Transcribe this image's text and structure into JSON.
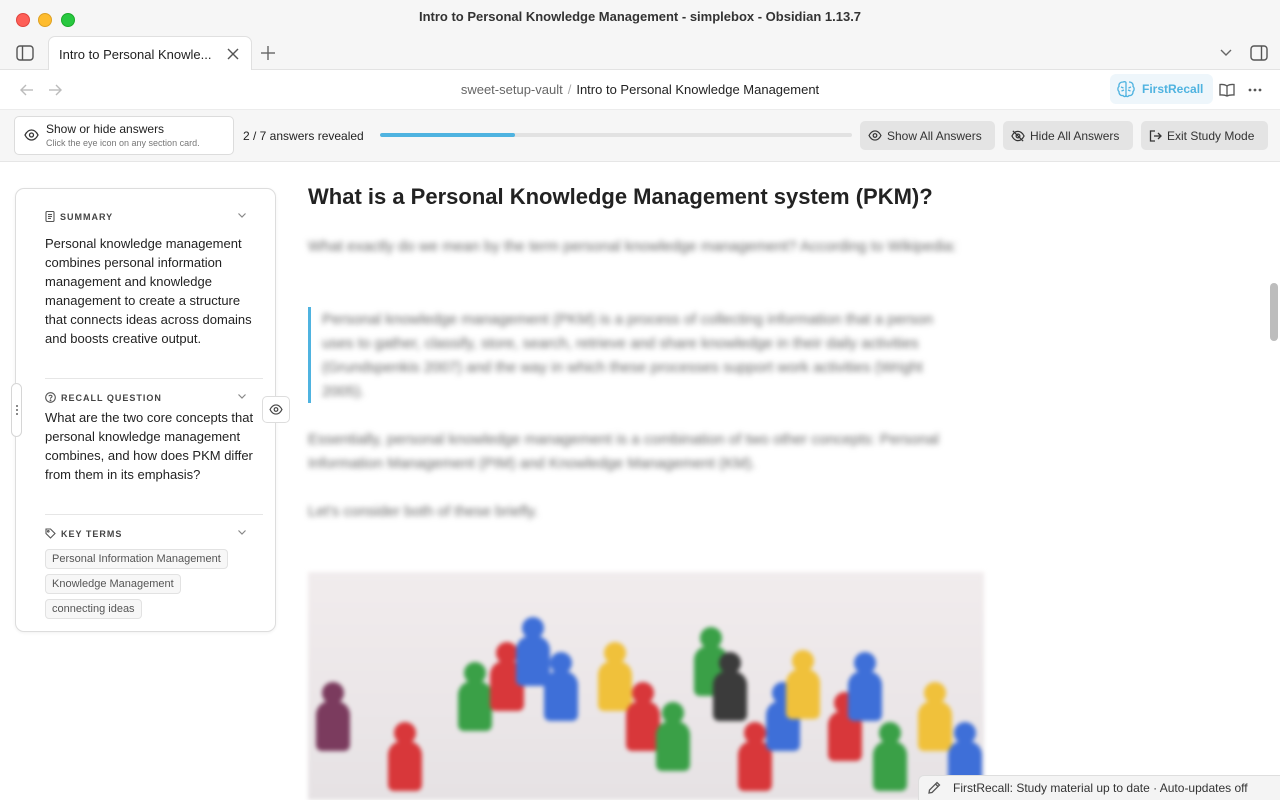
{
  "window": {
    "title": "Intro to Personal Knowledge Management - simplebox - Obsidian 1.13.7"
  },
  "tabs": [
    {
      "label": "Intro to Personal Knowle..."
    }
  ],
  "breadcrumb": {
    "vault": "sweet-setup-vault",
    "separator": "/",
    "note": "Intro to Personal Knowledge Management"
  },
  "plugin": {
    "name": "FirstRecall",
    "accent": "#4fb3e0"
  },
  "study_bar": {
    "hint_title": "Show or hide answers",
    "hint_subtitle": "Click the eye icon on any section card.",
    "progress_text": "2 / 7 answers revealed",
    "revealed": 2,
    "total": 7,
    "show_all": "Show All Answers",
    "hide_all": "Hide All Answers",
    "exit": "Exit Study Mode"
  },
  "card": {
    "summary_label": "SUMMARY",
    "summary_text": "Personal knowledge management combines personal information management and knowledge management to create a structure that connects ideas across domains and boosts creative output.",
    "recall_label": "RECALL QUESTION",
    "recall_text": "What are the two core concepts that personal knowledge management combines, and how does PKM differ from them in its emphasis?",
    "terms_label": "KEY TERMS",
    "terms": [
      "Personal Information Management",
      "Knowledge Management",
      "connecting ideas"
    ]
  },
  "note": {
    "heading": "What is a Personal Knowledge Management system (PKM)?",
    "para1": "What exactly do we mean by the term personal knowledge management? According to Wikipedia:",
    "quote": "Personal knowledge management (PKM) is a process of collecting information that a person uses to gather, classify, store, search, retrieve and share knowledge in their daily activities (Grundspenkis 2007) and the way in which these processes support work activities (Wright 2005).",
    "para2": "Essentially, personal knowledge management is a combination of two other concepts: Personal Information Management (PIM) and Knowledge Management (KM).",
    "para3": "Let's consider both of these briefly."
  },
  "status": {
    "text": "FirstRecall: Study material up to date · Auto-updates off"
  },
  "icons": {
    "sidebar_toggle": "sidebar-left-icon",
    "close": "close-icon",
    "new_tab": "plus-icon",
    "tab_list": "chevron-down-icon",
    "right_sidebar": "sidebar-right-icon",
    "back": "arrow-left-icon",
    "forward": "arrow-right-icon",
    "reading_view": "book-open-icon",
    "more": "more-horizontal-icon",
    "eye": "eye-icon",
    "eye_off": "eye-off-icon",
    "exit": "log-out-icon",
    "summary": "document-icon",
    "recall": "question-circle-icon",
    "terms": "tag-icon",
    "pencil": "pencil-icon"
  }
}
